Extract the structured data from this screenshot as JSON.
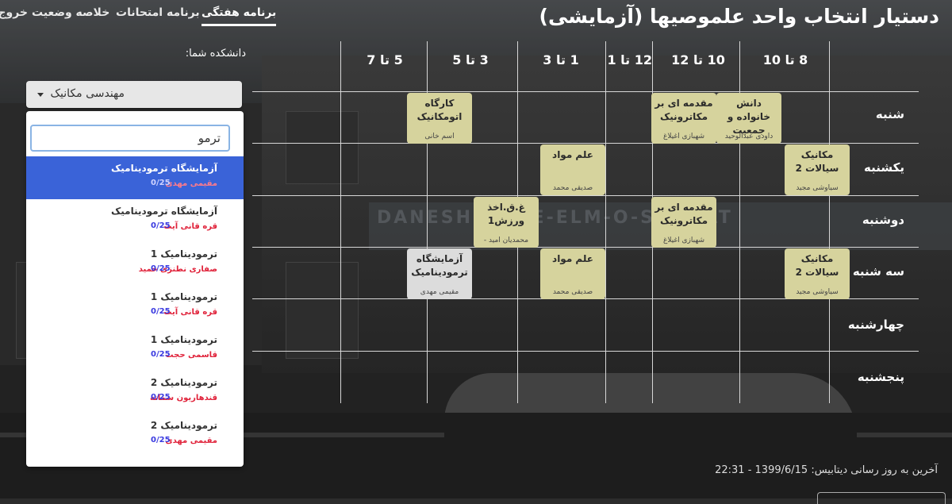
{
  "app_title": "دستیار انتخاب واحد علموصیها (آزمایشی)",
  "nav": {
    "weekly": "برنامه هفتگی",
    "exams": "برنامه امتحانات",
    "summary": "خلاصه وضعیت",
    "logout": "خروج"
  },
  "faculty": {
    "label": "دانشکده شما:",
    "selected": "مهندسی مکانیک"
  },
  "search": {
    "value": "ترمو"
  },
  "options": [
    {
      "title": "آزمایشگاه ترمودینامیک",
      "prof": "مقیمی مهدی",
      "cap": "0/25"
    },
    {
      "title": "آزمایشگاه ترمودینامیک",
      "prof": "قره قانی آیت",
      "cap": "0/25"
    },
    {
      "title": "ترمودینامیک 1",
      "prof": "صفاری نطنزی حمید",
      "cap": "0/25"
    },
    {
      "title": "ترمودینامیک 1",
      "prof": "قره قانی آیت",
      "cap": "0/25"
    },
    {
      "title": "ترمودینامیک 1",
      "prof": "قاسمی حجت",
      "cap": "0/25"
    },
    {
      "title": "ترمودینامیک 2",
      "prof": "قندهاریون سمانه",
      "cap": "0/25"
    },
    {
      "title": "ترمودینامیک 2",
      "prof": "مقیمی مهدی",
      "cap": "0/25"
    }
  ],
  "times": [
    "8 تا 10",
    "10 تا 12",
    "12 تا 1",
    "1 تا 3",
    "3 تا 5",
    "5 تا 7"
  ],
  "days": [
    "شنبه",
    "یکشنبه",
    "دوشنبه",
    "سه شنبه",
    "چهارشنبه",
    "پنجشنبه"
  ],
  "classes": [
    {
      "name": "دانش خانواده و جمعیت",
      "instructor": "داودی عبدالوحید"
    },
    {
      "name": "مقدمه ای بر مکاترونیک",
      "instructor": "شهبازی اغیلاغ"
    },
    {
      "name": "کارگاه اتومکانیک",
      "instructor": "اسم خانی"
    },
    {
      "name": "مکانیک سیالات 2",
      "instructor": "سیاوشی مجید"
    },
    {
      "name": "علم مواد",
      "instructor": "صدیقی محمد"
    },
    {
      "name": "مقدمه ای بر مکاترونیک",
      "instructor": "شهبازی اغیلاغ"
    },
    {
      "name": "غ.ق.اخذ ورزش1",
      "instructor": "محمدیان امید -"
    },
    {
      "name": "مکانیک سیالات 2",
      "instructor": "سیاوشی مجید"
    },
    {
      "name": "علم مواد",
      "instructor": "صدیقی محمد"
    },
    {
      "name": "آزمایشگاه ترمودینامیک",
      "instructor": "مقیمی مهدی"
    }
  ],
  "background_sign": "DANESHGAH-E-ELM-O-SANAAT",
  "footer": {
    "last_update": "آخرین به روز رسانی دیتابیس: 1399/6/15 - 22:31"
  }
}
